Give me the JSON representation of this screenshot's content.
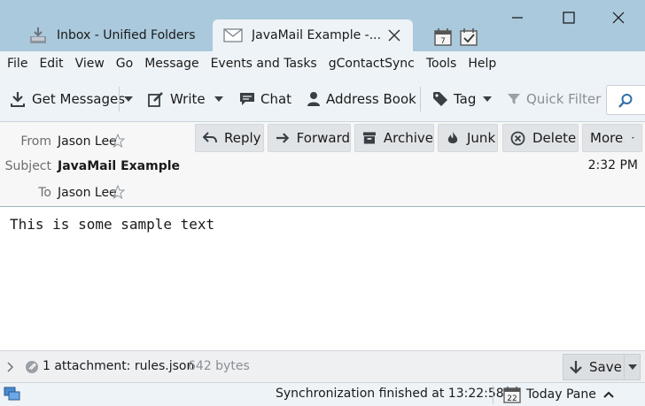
{
  "window": {
    "tabs": [
      {
        "label": "Inbox - Unified Folders",
        "icon": "inbox-download-icon"
      },
      {
        "label": "JavaMail Example -...",
        "icon": "envelope-icon"
      }
    ],
    "tab_bar_icons": [
      "calendar-icon",
      "tasks-icon"
    ],
    "controls": [
      "minimize-icon",
      "maximize-icon",
      "close-icon"
    ]
  },
  "menubar": {
    "items": [
      {
        "label": "File"
      },
      {
        "label": "Edit"
      },
      {
        "label": "View"
      },
      {
        "label": "Go"
      },
      {
        "label": "Message"
      },
      {
        "label": "Events and Tasks"
      },
      {
        "label": "gContactSync"
      },
      {
        "label": "Tools"
      },
      {
        "label": "Help"
      }
    ]
  },
  "toolbar": {
    "get_messages": "Get Messages",
    "write": "Write",
    "chat": "Chat",
    "address_book": "Address Book",
    "tag": "Tag",
    "quick_filter": "Quick Filter"
  },
  "header": {
    "from_label": "From",
    "from_value": "Jason Lee",
    "subject_label": "Subject",
    "subject_value": "JavaMail Example",
    "to_label": "To",
    "to_value": "Jason Lee",
    "time": "2:32 PM",
    "buttons": {
      "reply": "Reply",
      "forward": "Forward",
      "archive": "Archive",
      "junk": "Junk",
      "delete": "Delete",
      "more": "More"
    }
  },
  "message": {
    "body": "This is some sample text"
  },
  "attachments": {
    "summary": "1 attachment: rules.json",
    "size": "642 bytes",
    "save": "Save"
  },
  "statusbar": {
    "text": "Synchronization finished at 13:22:58",
    "today_pane": "Today Pane",
    "calendar_day": "22"
  },
  "colors": {
    "titlebar": "#aac9dc",
    "chrome": "#eef3f7",
    "header_bg": "#f7f7f7",
    "accent_blue": "#2f6fa8"
  }
}
